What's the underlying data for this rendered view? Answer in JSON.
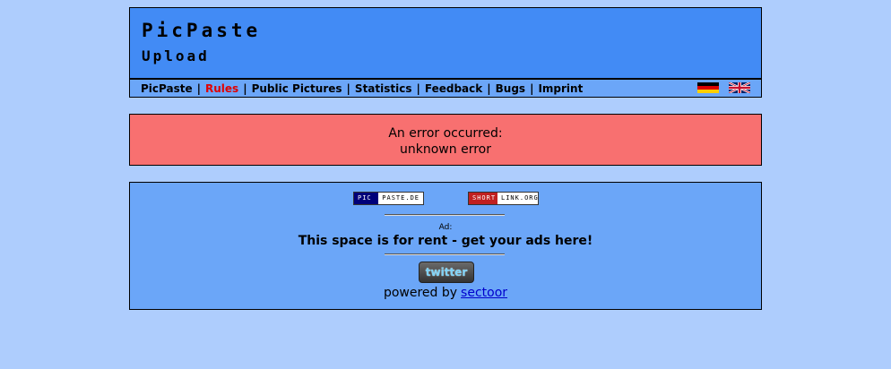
{
  "header": {
    "title": "PicPaste",
    "subtitle": "Upload"
  },
  "nav": {
    "items": [
      {
        "label": "PicPaste",
        "active": false
      },
      {
        "label": "Rules",
        "active": true
      },
      {
        "label": "Public Pictures",
        "active": false
      },
      {
        "label": "Statistics",
        "active": false
      },
      {
        "label": "Feedback",
        "active": false
      },
      {
        "label": "Bugs",
        "active": false
      },
      {
        "label": "Imprint",
        "active": false
      }
    ],
    "separator": "|",
    "active_color": "#e00000"
  },
  "flags": {
    "de": "german-flag-icon",
    "uk": "uk-flag-icon"
  },
  "error": {
    "line1": "An error occurred:",
    "line2": "unknown error",
    "background": "#f87070"
  },
  "footer": {
    "badge_picpaste": {
      "left": "PIC",
      "right": "PASTE.DE"
    },
    "badge_shortlink": {
      "left": "SHORT",
      "right": "LINK.ORG"
    },
    "ad_label": "Ad:",
    "ad_text": "This space is for rent - get your ads here!",
    "twitter_label": "twitter",
    "powered_by": "powered by",
    "powered_link": "sectoor"
  },
  "colors": {
    "page_background": "#aecdfd",
    "header_background": "#428bf5",
    "nav_background": "#6ba6f8"
  }
}
